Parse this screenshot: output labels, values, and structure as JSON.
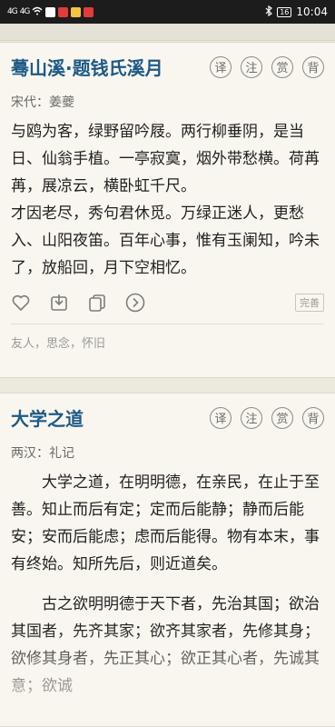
{
  "status": {
    "time": "10:04",
    "battery": "16",
    "signal1": "4G",
    "signal2": "4G"
  },
  "cards": [
    {
      "title": "蓦山溪·题钱氏溪月",
      "author": "宋代：姜夔",
      "actions": [
        "译",
        "注",
        "赏",
        "背"
      ],
      "lines": [
        "与鸥为客，绿野留吟屐。两行柳垂阴，是当日、仙翁手植。一亭寂寞，烟外带愁横。荷苒苒，展凉云，横卧虹千尺。",
        "才因老尽，秀句君休觅。万绿正迷人，更愁入、山阳夜笛。百年心事，惟有玉阑知，吟未了，放船回，月下空相忆。"
      ],
      "complete_label": "完善",
      "tags": "友人，思念，怀旧"
    },
    {
      "title": "大学之道",
      "author": "两汉：礼记",
      "actions": [
        "译",
        "注",
        "赏",
        "背"
      ],
      "paragraphs": [
        "大学之道，在明明德，在亲民，在止于至善。知止而后有定；定而后能静；静而后能安；安而后能虑；虑而后能得。物有本末，事有终始。知所先后，则近道矣。",
        "古之欲明明德于天下者，先治其国；欲治其国者，先齐其家；欲齐其家者，先修其身；欲修其身者，先正其心；欲正其心者，先诚其意；欲诚"
      ]
    }
  ]
}
